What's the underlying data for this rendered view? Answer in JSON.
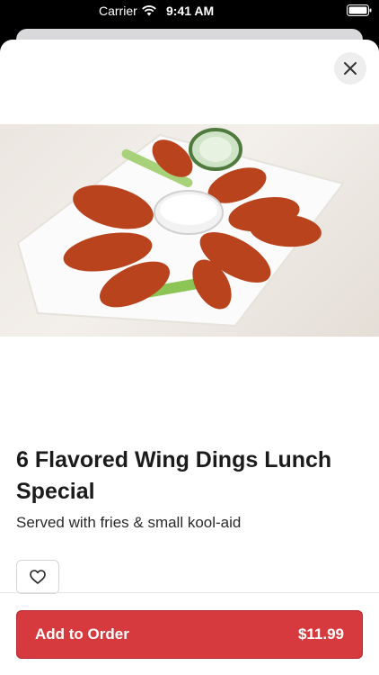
{
  "status_bar": {
    "carrier": "Carrier",
    "time": "9:41 AM"
  },
  "product": {
    "title": "6 Flavored Wing Dings Lunch Special",
    "description": "Served with fries & small kool-aid",
    "image_alt": "Plate of buffalo wings with celery, cucumber and ranch dip"
  },
  "actions": {
    "add_to_order": "Add to Order",
    "price": "$11.99"
  },
  "colors": {
    "accent": "#d63a3f"
  }
}
